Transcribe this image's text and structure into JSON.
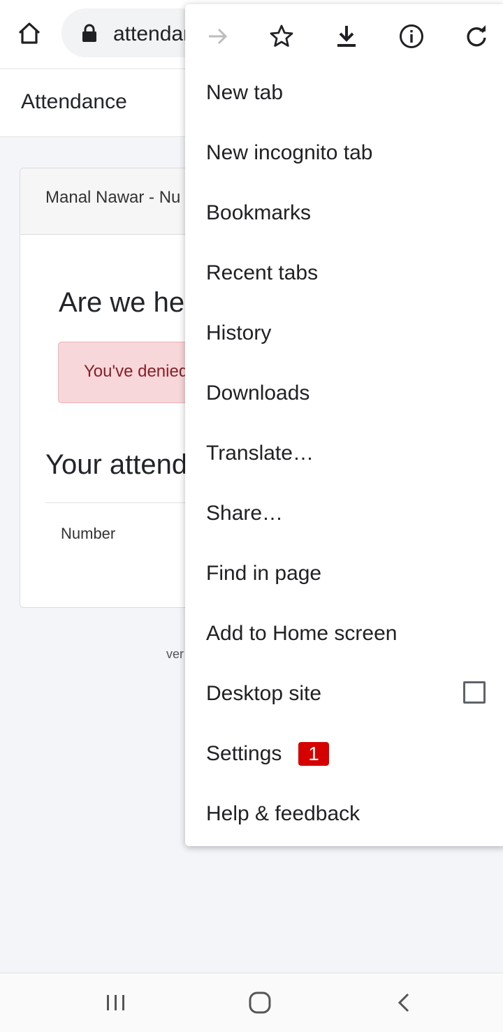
{
  "browser": {
    "url_display": "attendance.",
    "home_icon": "home-icon",
    "lock_icon": "lock-icon"
  },
  "appbar": {
    "title": "Attendance"
  },
  "card": {
    "header": "Manal Nawar - Nu",
    "question": "Are we here?",
    "alert_text": "You've denied location access",
    "section_title": "Your attendance",
    "column_header": "Number"
  },
  "footer": {
    "text": "ver"
  },
  "menu": {
    "icons": [
      "forward-arrow-icon",
      "star-icon",
      "download-icon",
      "info-icon",
      "reload-icon"
    ],
    "items": [
      {
        "label": "New tab"
      },
      {
        "label": "New incognito tab"
      },
      {
        "label": "Bookmarks"
      },
      {
        "label": "Recent tabs"
      },
      {
        "label": "History"
      },
      {
        "label": "Downloads"
      },
      {
        "label": "Translate…"
      },
      {
        "label": "Share…"
      },
      {
        "label": "Find in page"
      },
      {
        "label": "Add to Home screen"
      },
      {
        "label": "Desktop site",
        "checked": false
      },
      {
        "label": "Settings",
        "badge": "1"
      },
      {
        "label": "Help & feedback"
      }
    ]
  },
  "colors": {
    "alert_bg": "#f8d7da",
    "alert_text": "#842029",
    "badge_bg": "#d50000",
    "page_bg": "#f4f5f8"
  },
  "nav": {
    "icons": [
      "recents-icon",
      "home-circle-icon",
      "back-icon"
    ]
  }
}
